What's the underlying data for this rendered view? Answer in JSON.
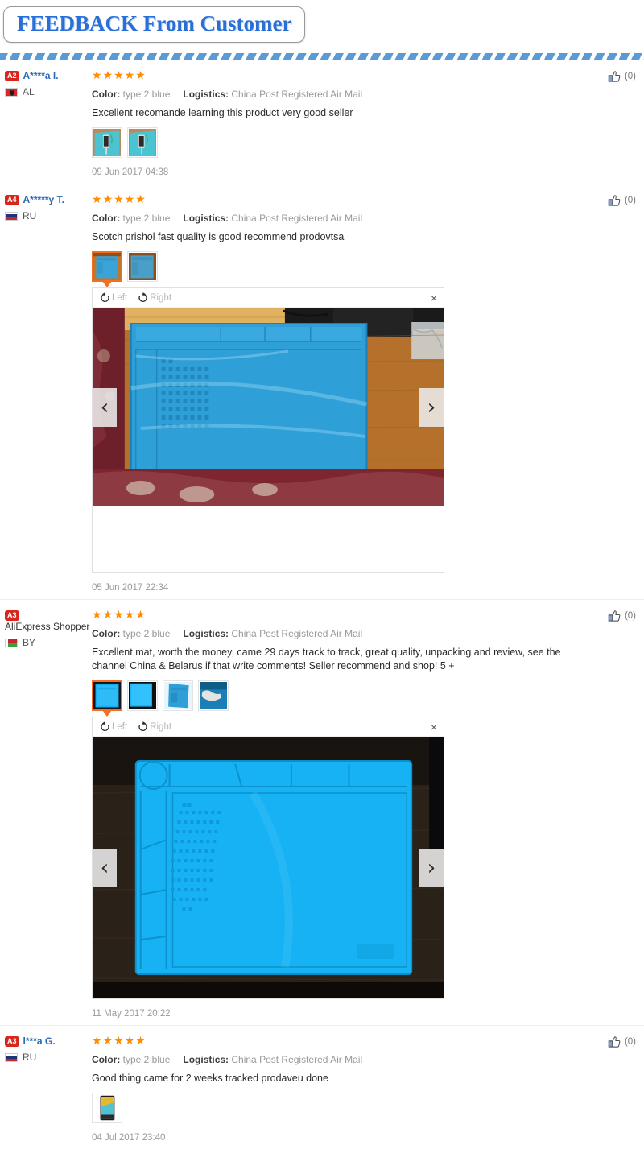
{
  "header": {
    "title": "FEEDBACK From Customer"
  },
  "viewer_ui": {
    "rotate_left_label": "Left",
    "rotate_right_label": "Right",
    "close_label": "×",
    "prev_label": "‹",
    "next_label": "›"
  },
  "labels": {
    "color_label": "Color:",
    "logistics_label": "Logistics:"
  },
  "colors": {
    "accent_blue": "#2a6fd6",
    "star_orange": "#ff8b00",
    "badge_red": "#d9261c",
    "thumb_selected": "#f36f21",
    "username_blue": "#2a6ab5",
    "muted_gray": "#999999"
  },
  "reviews": [
    {
      "level_badge": "A2",
      "user_name": "A****a l.",
      "country_code": "AL",
      "flag_class": "flag-al",
      "stars": 5,
      "color_value": "type 2 blue",
      "logistics_value": "China Post Registered Air Mail",
      "text": "Excellent recomande learning this product very good seller",
      "timestamp": "09 Jun 2017 04:38",
      "likes": "(0)",
      "thumbs": [
        "phone-on-teal-mat-1",
        "phone-on-teal-mat-2"
      ],
      "selected_thumb": -1,
      "viewer": null
    },
    {
      "level_badge": "A4",
      "user_name": "A*****y T.",
      "country_code": "RU",
      "flag_class": "flag-ru",
      "stars": 5,
      "color_value": "type 2 blue",
      "logistics_value": "China Post Registered Air Mail",
      "text": "Scotch prishol fast quality is good recommend prodovtsa",
      "timestamp": "05 Jun 2017 22:34",
      "likes": "(0)",
      "thumbs": [
        "blue-mat-wood-table-1",
        "blue-mat-wood-table-2"
      ],
      "selected_thumb": 0,
      "viewer": {
        "image": "blue-mat-on-wooden-table",
        "has_whitespace": true
      }
    },
    {
      "level_badge": "A3",
      "user_name": "AliExpress Shopper",
      "country_code": "BY",
      "flag_class": "flag-by",
      "stars": 5,
      "color_value": "type 2 blue",
      "logistics_value": "China Post Registered Air Mail",
      "text": "Excellent mat, worth the money, came 29 days track to track, great quality, unpacking and review, see the channel China & Belarus if that write comments! Seller recommend and shop! 5 +",
      "timestamp": "11 May 2017 20:22",
      "likes": "(0)",
      "thumbs": [
        "bright-blue-mat-1",
        "bright-blue-mat-2",
        "blue-mat-angled",
        "hand-on-blue-mat"
      ],
      "selected_thumb": 0,
      "viewer": {
        "image": "bright-blue-mat-dark-table",
        "has_whitespace": false
      }
    },
    {
      "level_badge": "A3",
      "user_name": "l***a G.",
      "country_code": "RU",
      "flag_class": "flag-ru",
      "stars": 5,
      "color_value": "type 2 blue",
      "logistics_value": "China Post Registered Air Mail",
      "text": "Good thing came for 2 weeks tracked prodaveu done",
      "timestamp": "04 Jul 2017 23:40",
      "likes": "(0)",
      "thumbs": [
        "phone-on-mat-vertical"
      ],
      "selected_thumb": -1,
      "viewer": null
    }
  ]
}
